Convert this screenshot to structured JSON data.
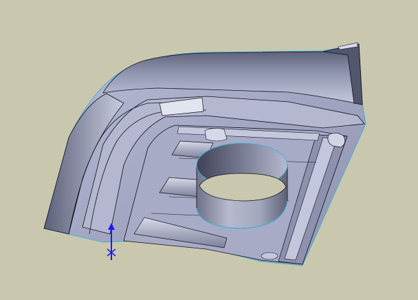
{
  "viewport": {
    "background_color": "#c9c7ad",
    "model": {
      "description_name": "cad-part",
      "face_color": "#9ca1bd",
      "edge_color": "#0f0f18",
      "silhouette_color": "#3fb3d9"
    },
    "triad": {
      "axis_color": "#1a1aff",
      "icon": "coordinate-triad-icon"
    }
  }
}
